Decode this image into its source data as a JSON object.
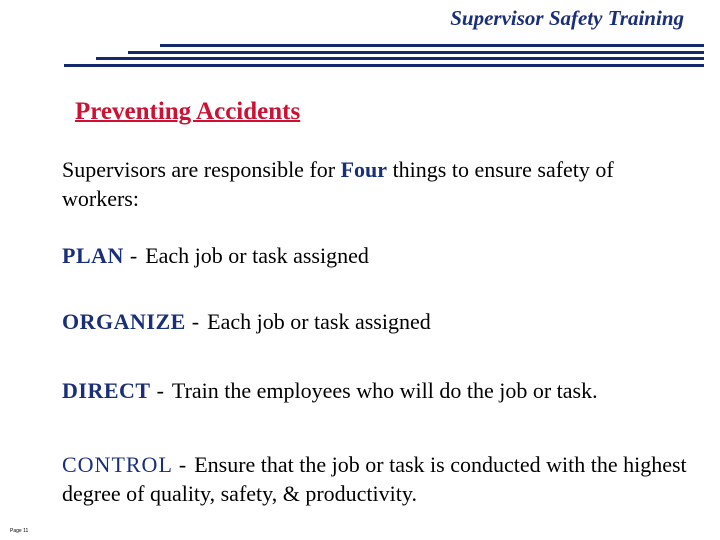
{
  "header": {
    "title": "Supervisor Safety Training"
  },
  "slide": {
    "title": "Preventing Accidents",
    "intro_before": "Supervisors are responsible for ",
    "intro_emphasis": "Four",
    "intro_after": " things to ensure safety of workers:",
    "items": [
      {
        "label": "PLAN",
        "separator": "-",
        "text": "Each job or task assigned"
      },
      {
        "label": "ORGANIZE",
        "separator": "-",
        "text": "Each job or task assigned"
      },
      {
        "label": "DIRECT",
        "separator": "-",
        "text": "Train the employees who will do the job or task."
      },
      {
        "label": "CONTROL",
        "separator": "-",
        "text": "Ensure that the job or task is conducted with the highest degree of quality, safety, & productivity."
      }
    ]
  },
  "footer": {
    "page": "Page 11"
  },
  "colors": {
    "title_red": "#cc1133",
    "accent_blue": "#1a2f7a"
  }
}
